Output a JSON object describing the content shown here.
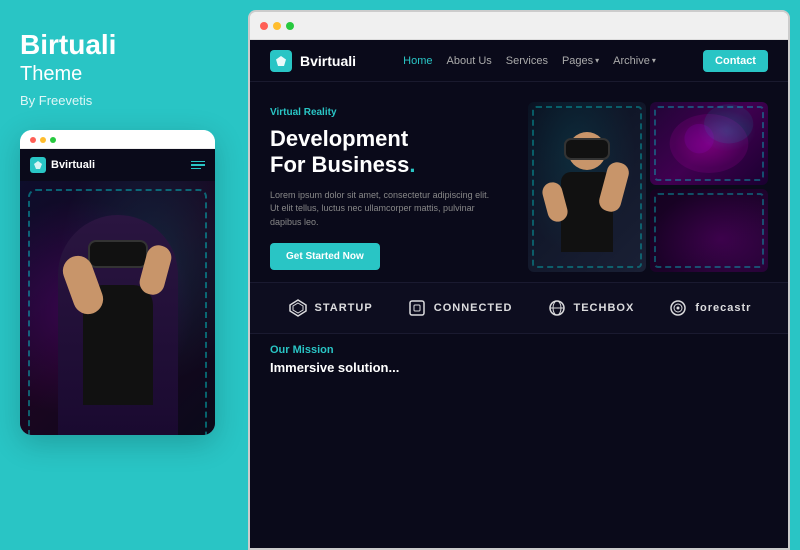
{
  "left": {
    "brand_title": "Birtuali",
    "brand_subtitle": "Theme",
    "brand_by": "By Freevetis",
    "mobile_nav_brand": "Bvirtuali",
    "mobile_dots": [
      "red",
      "yellow",
      "green"
    ]
  },
  "right": {
    "browser_dots": [
      "red",
      "yellow",
      "green"
    ],
    "nav": {
      "brand": "Bvirtuali",
      "links": [
        {
          "label": "Home",
          "active": true
        },
        {
          "label": "About Us",
          "active": false
        },
        {
          "label": "Services",
          "active": false
        },
        {
          "label": "Pages",
          "active": false,
          "dropdown": true
        },
        {
          "label": "Archive",
          "active": false,
          "dropdown": true
        }
      ],
      "cta": "Contact"
    },
    "hero": {
      "tag": "Virtual Reality",
      "title_line1": "Development",
      "title_line2": "For Business.",
      "description": "Lorem ipsum dolor sit amet, consectetur adipiscing elit. Ut elit tellus, luctus nec ullamcorper mattis, pulvinar dapibus leo.",
      "cta_label": "Get Started Now"
    },
    "logos": [
      {
        "name": "STARTUP"
      },
      {
        "name": "CONNECTED"
      },
      {
        "name": "TECHBOX"
      },
      {
        "name": "forecastr"
      }
    ],
    "mission": {
      "tag": "Our Mission",
      "subtitle": "Immersive solution..."
    }
  }
}
